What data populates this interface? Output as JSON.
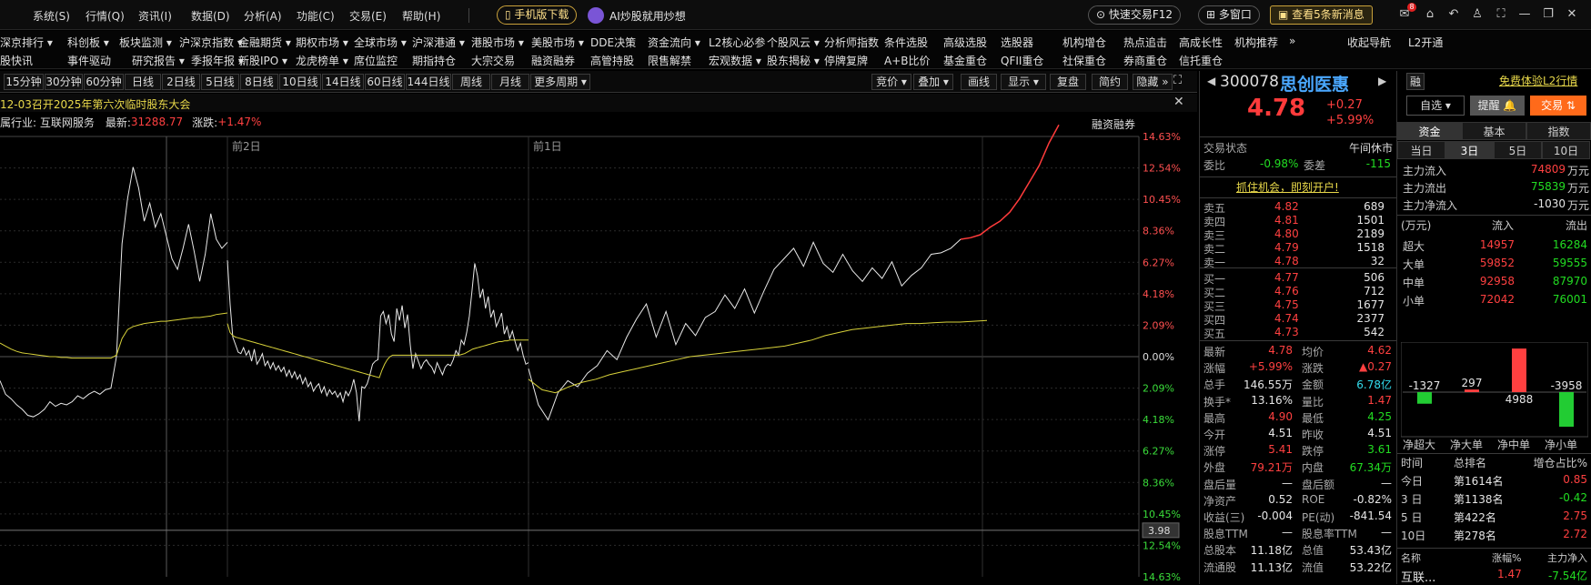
{
  "menu": {
    "items": [
      "系统(S)",
      "行情(Q)",
      "资讯(I)",
      "数据(D)",
      "分析(A)",
      "功能(C)",
      "交易(E)",
      "帮助(H)"
    ],
    "mobile_download": "手机版下载",
    "ai_label": "AI炒股就用炒想",
    "quick_trade": "快速交易F12",
    "multi_window": "多窗口",
    "news_button": "查看5条新消息",
    "mail_badge": "8"
  },
  "nav": {
    "row1": [
      "深京排行 ▾",
      "科创板 ▾",
      "板块监测 ▾",
      "沪深京指数 ▾",
      "金融期货 ▾",
      "期权市场 ▾",
      "全球市场 ▾",
      "沪深港通 ▾",
      "港股市场 ▾",
      "美股市场 ▾",
      "DDE决策",
      "资金流向 ▾",
      "L2核心必参",
      "个股风云 ▾",
      "分析师指数",
      "条件选股",
      "高级选股",
      "选股器",
      "机构增仓",
      "热点追击",
      "高成长性",
      "机构推荐",
      "»",
      "收起导航",
      "L2开通"
    ],
    "row2": [
      "股快讯",
      "事件驱动",
      "研究报告 ▾",
      "季报年报 ▾",
      "新股IPO ▾",
      "龙虎榜单 ▾",
      "席位监控",
      "期指持仓",
      "大宗交易",
      "融资融券",
      "高管持股",
      "限售解禁",
      "宏观数据 ▾",
      "股东揭秘 ▾",
      "停牌复牌",
      "A+B比价",
      "基金重仓",
      "QFII重仓",
      "社保重仓",
      "券商重仓",
      "信托重仓"
    ]
  },
  "periods": [
    "15分钟",
    "30分钟",
    "60分钟",
    "日线",
    "2日线",
    "5日线",
    "8日线",
    "10日线",
    "14日线",
    "60日线",
    "144日线",
    "周线",
    "月线",
    "更多周期 ▾"
  ],
  "chart_tools": [
    "竞价 ▾",
    "叠加 ▾",
    "画线",
    "显示 ▾",
    "复盘",
    "简约",
    "隐藏 »"
  ],
  "chart_info": {
    "announcement": "12-03召开2025年第六次临时股东大会",
    "industry": "属行业: 互联网服务",
    "latest_label": "最新:",
    "latest_value": "31288.77",
    "change_label": "涨跌:",
    "change_value": "+1.47%",
    "rz_label": "融资融券",
    "day_labels": [
      "前2日",
      "前1日"
    ],
    "cursor_value": "3.98"
  },
  "stock": {
    "code": "300078",
    "name": "思创医惠",
    "rong": "融",
    "l2_trial": "免费体验L2行情",
    "price": "4.78",
    "change": "+0.27",
    "change_pct": "+5.99%",
    "watch": "自选 ▾",
    "remind": "提醒 🔔",
    "trade": "交易 ⇅"
  },
  "order_book": {
    "status_label": "交易状态",
    "status": "午间休市",
    "weibi_label": "委比",
    "weibi": "-0.98%",
    "weicha_label": "委差",
    "weicha": "-115",
    "open_account": "抓住机会，即刻开户!",
    "asks": [
      {
        "label": "卖五",
        "price": "4.82",
        "vol": "689"
      },
      {
        "label": "卖四",
        "price": "4.81",
        "vol": "1501"
      },
      {
        "label": "卖三",
        "price": "4.80",
        "vol": "2189"
      },
      {
        "label": "卖二",
        "price": "4.79",
        "vol": "1518"
      },
      {
        "label": "卖一",
        "price": "4.78",
        "vol": "32"
      }
    ],
    "bids": [
      {
        "label": "买一",
        "price": "4.77",
        "vol": "506"
      },
      {
        "label": "买二",
        "price": "4.76",
        "vol": "712"
      },
      {
        "label": "买三",
        "price": "4.75",
        "vol": "1677"
      },
      {
        "label": "买四",
        "price": "4.74",
        "vol": "2377"
      },
      {
        "label": "买五",
        "price": "4.73",
        "vol": "542"
      }
    ]
  },
  "quote_stats": [
    {
      "l1": "最新",
      "v1": "4.78",
      "c1": "red",
      "l2": "均价",
      "v2": "4.62",
      "c2": "red"
    },
    {
      "l1": "涨幅",
      "v1": "+5.99%",
      "c1": "red",
      "l2": "涨跌",
      "v2": "▲0.27",
      "c2": "red"
    },
    {
      "l1": "总手",
      "v1": "146.55万",
      "c1": "white",
      "l2": "金额",
      "v2": "6.78亿",
      "c2": "cyan"
    },
    {
      "l1": "换手*",
      "v1": "13.16%",
      "c1": "white",
      "l2": "量比",
      "v2": "1.47",
      "c2": "red"
    },
    {
      "l1": "最高",
      "v1": "4.90",
      "c1": "red",
      "l2": "最低",
      "v2": "4.25",
      "c2": "green"
    },
    {
      "l1": "今开",
      "v1": "4.51",
      "c1": "white",
      "l2": "昨收",
      "v2": "4.51",
      "c2": "white"
    },
    {
      "l1": "涨停",
      "v1": "5.41",
      "c1": "red",
      "l2": "跌停",
      "v2": "3.61",
      "c2": "green"
    },
    {
      "l1": "外盘",
      "v1": "79.21万",
      "c1": "red",
      "l2": "内盘",
      "v2": "67.34万",
      "c2": "green"
    },
    {
      "l1": "盘后量",
      "v1": "—",
      "c1": "white",
      "l2": "盘后额",
      "v2": "—",
      "c2": "white"
    },
    {
      "l1": "净资产",
      "v1": "0.52",
      "c1": "white",
      "l2": "ROE",
      "v2": "-0.82%",
      "c2": "white"
    },
    {
      "l1": "收益(三)",
      "v1": "-0.004",
      "c1": "white",
      "l2": "PE(动)",
      "v2": "-841.54",
      "c2": "white"
    },
    {
      "l1": "股息TTM",
      "v1": "—",
      "c1": "white",
      "l2": "股息率TTM",
      "v2": "—",
      "c2": "white"
    },
    {
      "l1": "总股本",
      "v1": "11.18亿",
      "c1": "white",
      "l2": "总值",
      "v2": "53.43亿",
      "c2": "white"
    },
    {
      "l1": "流通股",
      "v1": "11.13亿",
      "c1": "white",
      "l2": "流值",
      "v2": "53.22亿",
      "c2": "white"
    }
  ],
  "fund": {
    "tabs": [
      "资金",
      "基本",
      "指数"
    ],
    "days": [
      "当日",
      "3日",
      "5日",
      "10日"
    ],
    "flow": [
      {
        "label": "主力流入",
        "value": "74809",
        "unit": "万元",
        "color": "red"
      },
      {
        "label": "主力流出",
        "value": "75839",
        "unit": "万元",
        "color": "green"
      },
      {
        "label": "主力净流入",
        "value": "-1030",
        "unit": "万元",
        "color": "white"
      }
    ],
    "table_head": [
      "(万元)",
      "流入",
      "流出"
    ],
    "table": [
      {
        "label": "超大",
        "in": "14957",
        "out": "16284"
      },
      {
        "label": "大单",
        "in": "59852",
        "out": "59555"
      },
      {
        "label": "中单",
        "in": "92958",
        "out": "87970"
      },
      {
        "label": "小单",
        "in": "72042",
        "out": "76001"
      }
    ],
    "net_bars": [
      {
        "label": "净超大",
        "value": -1327
      },
      {
        "label": "净大单",
        "value": 297
      },
      {
        "label": "净中单",
        "value": 4988
      },
      {
        "label": "净小单",
        "value": -3958
      }
    ],
    "rank_head": [
      "时间",
      "总排名",
      "增仓占比%"
    ],
    "ranks": [
      {
        "t": "今日",
        "r": "第1614名",
        "p": "0.85",
        "c": "red"
      },
      {
        "t": "3 日",
        "r": "第1138名",
        "p": "-0.42",
        "c": "green"
      },
      {
        "t": "5 日",
        "r": "第422名",
        "p": "2.75",
        "c": "red"
      },
      {
        "t": "10日",
        "r": "第278名",
        "p": "2.72",
        "c": "red"
      }
    ],
    "sector_head": [
      "名称",
      "涨幅%",
      "主力净入"
    ],
    "sector": {
      "name": "互联...",
      "pct": "1.47",
      "net": "-7.54亿"
    }
  },
  "chart_data": {
    "type": "line",
    "title": "",
    "xlabel": "",
    "ylabel": "",
    "ylim": [
      -14.63,
      14.63
    ],
    "right_ticks": [
      "14.63%",
      "12.54%",
      "10.45%",
      "8.36%",
      "6.27%",
      "4.18%",
      "2.09%",
      "0.00%",
      "2.09%",
      "4.18%",
      "6.27%",
      "8.36%",
      "10.45%",
      "12.54%",
      "14.63%"
    ],
    "tick_values": [
      14.63,
      12.54,
      10.45,
      8.36,
      6.27,
      4.18,
      2.09,
      0,
      -2.09,
      -4.18,
      -6.27,
      -8.36,
      -10.45,
      -12.54,
      -14.63
    ],
    "series": [
      {
        "role": "price_day_prev2",
        "values": [
          -1.6,
          -2.5,
          -2.8,
          -3.2,
          -3.5,
          -3.9,
          -4.0,
          -3.8,
          -3.5,
          -3.0,
          -3.3,
          -3.1,
          -3.2,
          -3.0,
          -2.6,
          -2.8,
          -2.5,
          -2.3,
          -2.5,
          -2.2,
          -2.1,
          0.0,
          7.5,
          10.5,
          12.6,
          11.2,
          9.0,
          10.2,
          8.6,
          9.5,
          8.0,
          6.5,
          5.8,
          7.2,
          8.8,
          7.0,
          5.0,
          6.8,
          9.5,
          7.8,
          7.2,
          7.6
        ]
      },
      {
        "role": "price_day_prev1",
        "values": [
          6.4,
          3.5,
          1.3,
          0.8,
          0.3,
          0.2,
          0.6,
          0.1,
          0.4,
          -0.3,
          0.5,
          -0.5,
          -0.2,
          0.2,
          -0.6,
          -0.3,
          -0.8,
          -0.4,
          -0.9,
          -0.6,
          -1.0,
          -0.7,
          -1.3,
          -0.9,
          -1.4,
          -1.0,
          -1.5,
          -1.2,
          -1.8,
          -1.4,
          -2.0,
          -1.7,
          -2.3,
          -2.0,
          -1.8,
          -2.4,
          -2.0,
          -2.6,
          -2.2,
          -2.5,
          -2.3,
          -2.7,
          -2.4,
          -3.0,
          -2.3,
          -2.6,
          -2.2,
          -1.5,
          -2.4,
          -4.3,
          -2.0,
          -2.1,
          -1.8,
          -1.2,
          -0.5,
          -0.3,
          -0.2,
          2.7,
          3.0,
          2.2,
          2.8,
          1.5,
          1.0,
          3.2,
          2.4,
          3.4,
          1.9,
          2.8,
          0.8,
          -0.8,
          0.2,
          -0.3,
          -0.8,
          -0.4,
          -0.2,
          -0.5,
          -0.7,
          -1.1,
          -0.4,
          -0.8,
          -1.2,
          -0.7,
          -0.5,
          -0.6,
          -0.2,
          0.4,
          0.1,
          1.1,
          0.8,
          1.6,
          2.7,
          4.4,
          6.2,
          5.4,
          3.9,
          4.5,
          3.2,
          4.0,
          2.6,
          3.1,
          2.0,
          2.4,
          2.9,
          1.5,
          2.0,
          1.2,
          1.7,
          1.0,
          0.4,
          0.9,
          0.1,
          -0.5,
          -0.4
        ]
      },
      {
        "role": "price_today",
        "values": [
          -0.8,
          -3.2,
          -4.2,
          -2.4,
          -1.6,
          -2.0,
          -1.1,
          -0.6,
          0.4,
          -0.2,
          1.3,
          2.5,
          3.5,
          1.3,
          3.0,
          0.8,
          2.2,
          1.4,
          2.6,
          3.0,
          4.1,
          3.2,
          4.5,
          2.9,
          4.4,
          5.8,
          6.5,
          7.2,
          6.0,
          7.6,
          6.2,
          5.6,
          6.8,
          5.7,
          5.0,
          5.9,
          5.2,
          6.3,
          4.7,
          5.4,
          5.9,
          6.8,
          6.9,
          7.2,
          7.8,
          7.9,
          8.1,
          8.6,
          9.0,
          9.6,
          10.5,
          11.6,
          12.7,
          14.2,
          15.4
        ]
      },
      {
        "role": "avg_prev2",
        "values": [
          0.9,
          0.7,
          0.5,
          0.35,
          0.25,
          0.2,
          0.15,
          0.1,
          0.05,
          0.0,
          0.0,
          -0.05,
          -0.05,
          -0.1,
          -0.1,
          -0.1,
          -0.1,
          -0.1,
          -0.1,
          -0.1,
          -0.1,
          0.1,
          1.2,
          1.8,
          2.0,
          2.1,
          2.2,
          2.25,
          2.3,
          2.35,
          2.35,
          2.4,
          2.45,
          2.5,
          2.55,
          2.6,
          2.6,
          2.65,
          2.7,
          2.8,
          2.85,
          2.9
        ]
      },
      {
        "role": "avg_prev1",
        "values": [
          2.2,
          1.6,
          1.4,
          1.3,
          1.25,
          1.2,
          1.15,
          1.1,
          1.05,
          1.0,
          0.95,
          0.9,
          0.85,
          0.8,
          0.75,
          0.7,
          0.65,
          0.6,
          0.55,
          0.5,
          0.45,
          0.4,
          0.35,
          0.3,
          0.25,
          0.2,
          0.15,
          0.1,
          0.05,
          0.0,
          -0.05,
          -0.1,
          -0.15,
          -0.2,
          -0.25,
          -0.3,
          -0.35,
          -0.4,
          -0.45,
          -0.5,
          -0.55,
          -0.6,
          -0.65,
          -0.7,
          -0.75,
          -0.8,
          -0.85,
          -0.9,
          -0.95,
          -1.0,
          -1.05,
          -1.1,
          -1.15,
          -1.2,
          -1.25,
          -1.3,
          -1.35,
          -1.4,
          -0.9,
          -0.5,
          -0.2,
          0.0,
          0.1,
          0.1,
          0.1,
          0.1,
          0.1,
          0.1,
          0.1,
          0.1,
          0.1,
          0.1,
          0.1,
          0.1,
          0.1,
          0.1,
          0.1,
          0.1,
          0.1,
          0.1,
          0.1,
          0.1,
          0.1,
          0.1,
          0.1,
          0.1,
          0.1,
          0.1,
          0.15,
          0.2,
          0.3,
          0.4,
          0.5,
          0.55,
          0.6,
          0.65,
          0.7,
          0.75,
          0.8,
          0.85,
          0.9,
          0.95,
          1.0,
          1.0,
          1.05,
          1.05,
          1.1,
          1.1,
          1.1,
          1.1,
          1.1,
          1.1,
          1.1,
          1.1
        ]
      },
      {
        "role": "avg_today",
        "values": [
          -1.5,
          -2.2,
          -2.4,
          -2.0,
          -1.7,
          -1.5,
          -1.2,
          -1.0,
          -0.8,
          -0.6,
          -0.4,
          -0.2,
          0.0,
          0.1,
          0.2,
          0.3,
          0.4,
          0.5,
          0.6,
          0.7,
          0.9,
          1.1,
          1.4,
          1.6,
          1.8,
          1.9,
          2.0,
          2.1,
          2.2,
          2.2,
          2.25,
          2.3,
          2.3,
          2.35,
          2.4
        ]
      }
    ]
  }
}
